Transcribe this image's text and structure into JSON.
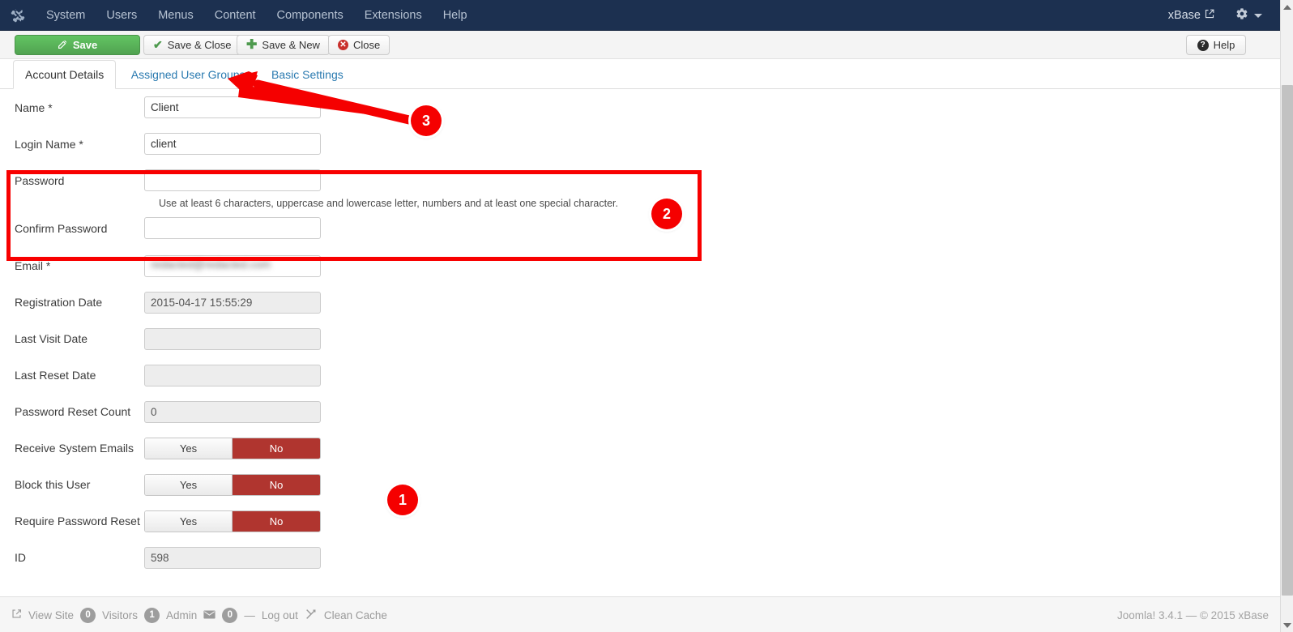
{
  "topbar": {
    "logo_icon": "joomla-logo-icon",
    "menu": [
      {
        "label": "System"
      },
      {
        "label": "Users"
      },
      {
        "label": "Menus"
      },
      {
        "label": "Content"
      },
      {
        "label": "Components"
      },
      {
        "label": "Extensions"
      },
      {
        "label": "Help"
      }
    ],
    "site_name": "xBase",
    "site_link_icon": "external-link-icon",
    "settings_icon": "gear-icon"
  },
  "toolbar": {
    "save": "Save",
    "save_close": "Save & Close",
    "save_new": "Save & New",
    "close": "Close",
    "help": "Help"
  },
  "tabs": [
    {
      "label": "Account Details",
      "active": true
    },
    {
      "label": "Assigned User Groups",
      "active": false
    },
    {
      "label": "Basic Settings",
      "active": false
    }
  ],
  "form": {
    "name": {
      "label": "Name *",
      "value": "Client"
    },
    "login_name": {
      "label": "Login Name *",
      "value": "client"
    },
    "password": {
      "label": "Password",
      "value": ""
    },
    "password_hint": "Use at least 6 characters, uppercase and lowercase letter, numbers and at least one special character.",
    "confirm_password": {
      "label": "Confirm Password",
      "value": ""
    },
    "email": {
      "label": "Email *",
      "value": "redacted@redacted.com",
      "redacted": true
    },
    "registration_date": {
      "label": "Registration Date",
      "value": "2015-04-17 15:55:29"
    },
    "last_visit_date": {
      "label": "Last Visit Date",
      "value": ""
    },
    "last_reset_date": {
      "label": "Last Reset Date",
      "value": ""
    },
    "password_reset_count": {
      "label": "Password Reset Count",
      "value": "0"
    },
    "receive_system_emails": {
      "label": "Receive System Emails",
      "yes": "Yes",
      "no": "No",
      "selected": "No"
    },
    "block_this_user": {
      "label": "Block this User",
      "yes": "Yes",
      "no": "No",
      "selected": "No"
    },
    "require_password_reset": {
      "label": "Require Password Reset",
      "yes": "Yes",
      "no": "No",
      "selected": "No"
    },
    "id": {
      "label": "ID",
      "value": "598"
    }
  },
  "annotations": {
    "badge1": "1",
    "badge2": "2",
    "badge3": "3",
    "highlight_color": "#f80000",
    "badge_color": "#f50000",
    "arrow_target": "Assigned User Groups tab"
  },
  "footer": {
    "view_site": "View Site",
    "view_site_icon": "external-link-icon",
    "visitors_count": "0",
    "visitors_label": "Visitors",
    "admin_count": "1",
    "admin_label": "Admin",
    "messages_icon": "envelope-icon",
    "messages_count": "0",
    "separator": "—",
    "log_out": "Log out",
    "clean_cache_icon": "broom-icon",
    "clean_cache": "Clean Cache",
    "copyright": "Joomla! 3.4.1  —  © 2015 xBase"
  }
}
